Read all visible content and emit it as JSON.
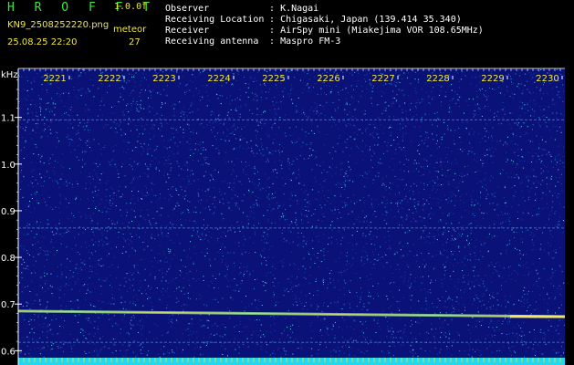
{
  "header": {
    "app_title": "H R O F F T",
    "version": "1.0.0f",
    "file_name": "KN9_2508252220.png",
    "mode": "meteor",
    "timestamp": "25.08.25 22:20",
    "count": "27"
  },
  "meta": [
    {
      "key": "Observer",
      "sep": ":",
      "value": "K.Nagai"
    },
    {
      "key": "Receiving Location",
      "sep": ":",
      "value": "Chigasaki, Japan (139.414 35.340)"
    },
    {
      "key": "Receiver",
      "sep": ":",
      "value": "AirSpy mini (Miakejima VOR 108.65MHz)"
    },
    {
      "key": "Receiving antenna",
      "sep": ":",
      "value": "Maspro FM-3"
    }
  ],
  "chart_data": {
    "type": "heatmap",
    "ylabel": "kHz",
    "y_ticks": [
      "1.1",
      "1.0",
      "0.9",
      "0.8",
      "0.7",
      "0.6"
    ],
    "y_tick_values": [
      1.1,
      1.0,
      0.9,
      0.8,
      0.7,
      0.6
    ],
    "x_ticks": [
      "2221",
      "2222",
      "2223",
      "2224",
      "2225",
      "2226",
      "2227",
      "2228",
      "2229",
      "2230"
    ],
    "ylim": [
      0.585,
      1.205
    ],
    "carrier_khz": 0.685,
    "carrier_khz_end": 0.673,
    "faint_lines_khz": [
      1.095,
      0.863,
      0.618
    ],
    "colors": {
      "background": "#0b1277",
      "noise_low": "#1a3fb0",
      "noise_mid": "#2d86e0",
      "noise_high": "#5fe0f0",
      "carrier": "#9ef08a",
      "carrier_peak": "#f0e860",
      "axis": "#ffffff",
      "tick_label": "#f2e63a",
      "header_green": "#39e83a",
      "bottom_band": "#22d8f0"
    }
  }
}
